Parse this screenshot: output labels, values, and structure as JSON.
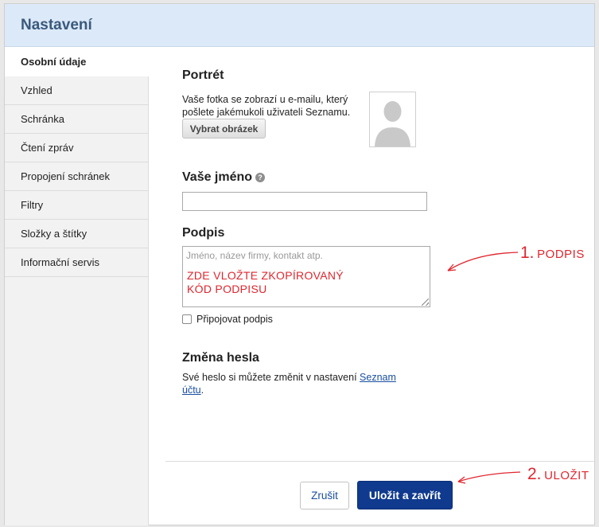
{
  "dialog": {
    "title": "Nastavení"
  },
  "sidebar": {
    "items": [
      {
        "label": "Osobní údaje"
      },
      {
        "label": "Vzhled"
      },
      {
        "label": "Schránka"
      },
      {
        "label": "Čtení zpráv"
      },
      {
        "label": "Propojení schránek"
      },
      {
        "label": "Filtry"
      },
      {
        "label": "Složky a štítky"
      },
      {
        "label": "Informační servis"
      }
    ],
    "active_index": 0
  },
  "portrait": {
    "title": "Portrét",
    "description": "Vaše fotka se zobrazí u e-mailu, který pošlete jakémukoli uživateli Seznamu.",
    "choose_button": "Vybrat obrázek",
    "avatar_icon": "person-silhouette-icon"
  },
  "name": {
    "title": "Vaše jméno",
    "help_icon": "question-icon",
    "value": ""
  },
  "signature": {
    "title": "Podpis",
    "placeholder": "Jméno, název firmy, kontakt atp.",
    "note_line1": "ZDE VLOŽTE ZKOPÍROVANÝ",
    "note_line2": "KÓD PODPISU",
    "attach_label": "Připojovat podpis",
    "attach_checked": false
  },
  "password": {
    "title": "Změna hesla",
    "text": "Své heslo si můžete změnit v nastavení ",
    "link_line1": "Seznam",
    "link_line2": "účtu",
    "suffix": "."
  },
  "footer": {
    "cancel_label": "Zrušit",
    "save_label": "Uložit a zavřít"
  },
  "annotations": {
    "first_number": "1.",
    "first_label": "PODPIS",
    "second_number": "2.",
    "second_label": "ULOŽIT",
    "color": "#e0262e"
  }
}
